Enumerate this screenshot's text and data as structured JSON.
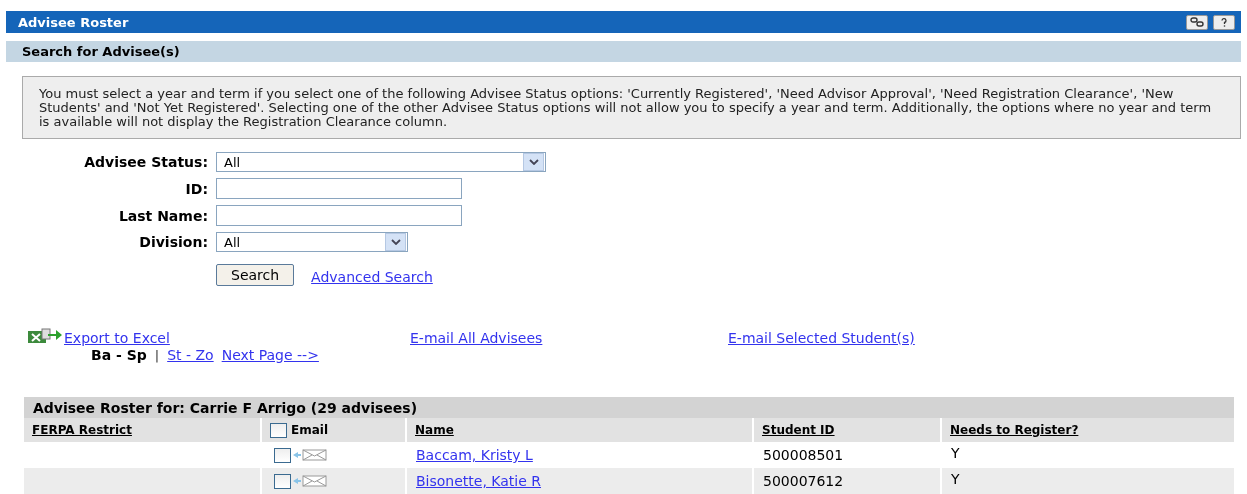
{
  "window": {
    "title": "Advisee Roster"
  },
  "section": {
    "title": "Search for Advisee(s)"
  },
  "notice": "You must select a year and term if you select one of the following Advisee Status options: 'Currently Registered', 'Need Advisor Approval', 'Need Registration Clearance', 'New Students' and 'Not Yet Registered'. Selecting one of the other Advisee Status options will not allow you to specify a year and term. Additionally, the options where no year and term is available will not display the Registration Clearance column.",
  "form": [
    {
      "kind": "wide-select",
      "label": "Advisee Status:",
      "value": "All"
    },
    {
      "kind": "text",
      "label": "ID:"
    },
    {
      "kind": "text",
      "label": "Last Name:"
    },
    {
      "kind": "narrow-select",
      "label": "Division:",
      "value": "All"
    }
  ],
  "search_button": "Search",
  "advanced_link": "Advanced Search",
  "actions": [
    "Export to Excel",
    "E-mail All Advisees",
    "E-mail Selected Student(s)"
  ],
  "pages": [
    {
      "label": "Ba - Sp",
      "selected": true
    },
    {
      "label": "St - Zo",
      "selected": false
    }
  ],
  "page_separator": "|",
  "next_page": "Next Page -->",
  "roster": {
    "title": "Advisee Roster for: Carrie F Arrigo (29 advisees)",
    "columns": [
      "FERPA Restrict",
      "Email",
      "Name",
      "Student ID",
      "Needs to Register?"
    ],
    "select_all": false,
    "rows": [
      {
        "checked": false,
        "name": "Baccam, Kristy L",
        "student_id": "500008501",
        "needs_register": "Y"
      },
      {
        "checked": false,
        "name": "Bisonette, Katie R",
        "student_id": "500007612",
        "needs_register": "Y"
      }
    ]
  }
}
